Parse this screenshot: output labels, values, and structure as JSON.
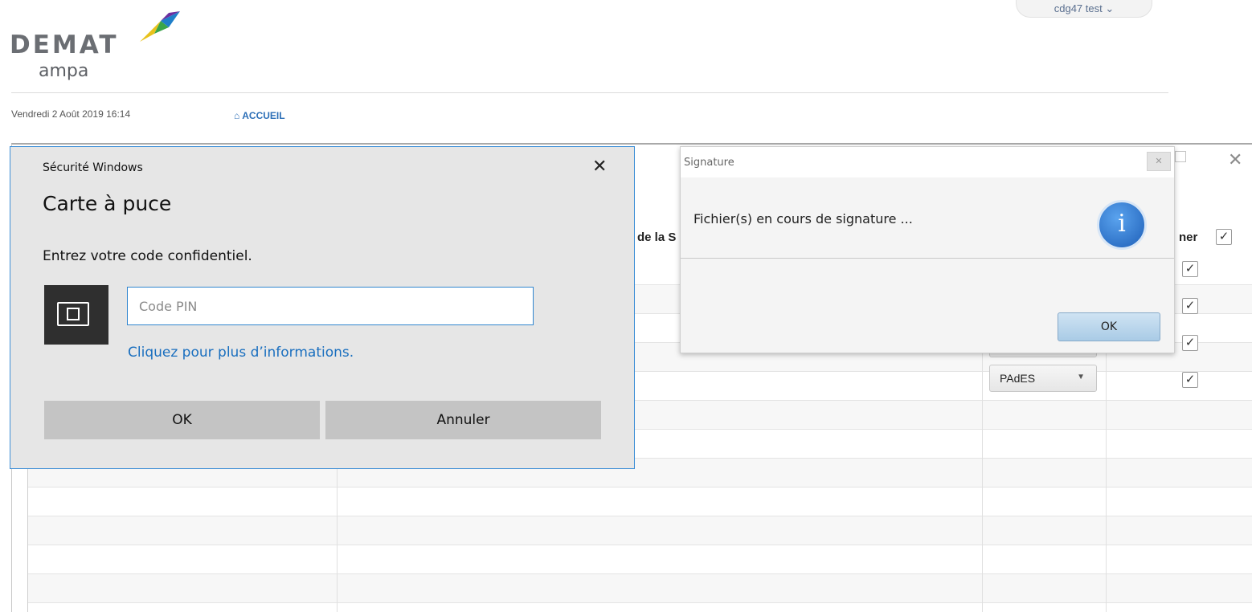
{
  "header": {
    "logo_word": "DEMAT",
    "logo_sub": "ampa",
    "user_menu": "cdg47 test",
    "date": "Vendredi 2 Août 2019 16:14",
    "nav_accueil": "ACCUEIL"
  },
  "table": {
    "header_col2": "de la S",
    "header_col4": "ner",
    "rows": [
      {
        "checked": true
      },
      {
        "checked": true
      },
      {
        "checked": true
      },
      {
        "format": "PAdES",
        "checked": true
      }
    ]
  },
  "windows_security": {
    "title": "Sécurité Windows",
    "heading": "Carte à puce",
    "prompt": "Entrez votre code confidentiel.",
    "pin_placeholder": "Code PIN",
    "pin_value": "",
    "info_link": "Cliquez pour plus d’informations.",
    "ok_label": "OK",
    "cancel_label": "Annuler",
    "icon": "smart-card-icon",
    "border_color": "#3d8ed6"
  },
  "signature_dialog": {
    "title": "Signature",
    "message": "Fichier(s) en cours de signature ...",
    "info_icon_glyph": "i",
    "ok_label": "OK"
  },
  "colors": {
    "link_blue": "#1a6fbf",
    "accent_blue": "#2c6fb7"
  }
}
